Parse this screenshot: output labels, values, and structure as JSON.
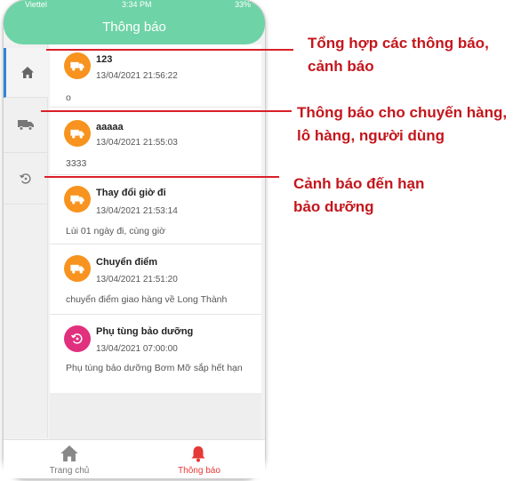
{
  "status_bar": {
    "carrier": "Viettel",
    "time": "3:34 PM",
    "battery": "33%"
  },
  "header": {
    "title": "Thông báo"
  },
  "side_rail": {
    "items": [
      {
        "icon": "home-icon",
        "active": true
      },
      {
        "icon": "truck-icon",
        "active": false
      },
      {
        "icon": "maintenance-icon",
        "active": false
      }
    ]
  },
  "notifications": [
    {
      "icon": "truck-icon",
      "color": "#f7931e",
      "title": "123",
      "time": "13/04/2021 21:56:22",
      "body": "o"
    },
    {
      "icon": "truck-icon",
      "color": "#f7931e",
      "title": "aaaaa",
      "time": "13/04/2021 21:55:03",
      "body": "3333"
    },
    {
      "icon": "truck-icon",
      "color": "#f7931e",
      "title": "Thay đổi giờ đi",
      "time": "13/04/2021 21:53:14",
      "body": "Lùi 01 ngày đi, cùng giờ"
    },
    {
      "icon": "truck-icon",
      "color": "#f7931e",
      "title": "Chuyển điểm",
      "time": "13/04/2021 21:51:20",
      "body": "chuyển điểm giao hàng về Long Thành"
    },
    {
      "icon": "maintenance-icon",
      "color": "#e0307e",
      "title": "Phụ tùng bảo dưỡng",
      "time": "13/04/2021 07:00:00",
      "body": "Phụ tùng bảo dưỡng Bơm Mỡ sắp hết hạn"
    }
  ],
  "bottom_nav": {
    "home_label": "Trang chủ",
    "notifications_label": "Thông báo",
    "inactive_color": "#777777",
    "active_color": "#e53935"
  },
  "annotations": {
    "summary": [
      "Tổng hợp các thông báo,",
      "cảnh báo"
    ],
    "shipment": [
      "Thông báo cho chuyến hàng,",
      "lô hàng, người dùng"
    ],
    "maintenance": [
      "Cảnh báo đến hạn",
      "bảo dưỡng"
    ],
    "color": "#c4161c"
  }
}
